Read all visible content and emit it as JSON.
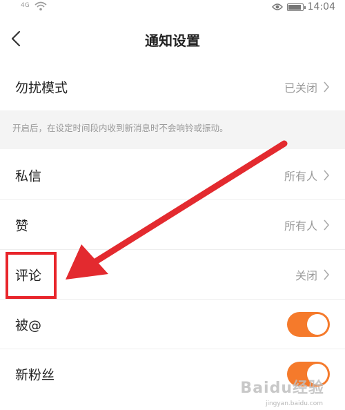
{
  "status_bar": {
    "signal": "4G",
    "time": "14:04",
    "icons": [
      "signal-icon",
      "wifi-icon",
      "eye-icon",
      "battery-icon"
    ]
  },
  "header": {
    "title": "通知设置",
    "back_icon": "chevron-left-icon"
  },
  "settings": {
    "dnd": {
      "label": "勿扰模式",
      "value": "已关闭"
    },
    "hint": "开启后，在设定时间段内收到新消息时不会响铃或振动。",
    "private_message": {
      "label": "私信",
      "value": "所有人"
    },
    "likes": {
      "label": "赞",
      "value": "所有人"
    },
    "comments": {
      "label": "评论",
      "value": "关闭"
    },
    "mentions": {
      "label": "被@",
      "enabled": true
    },
    "new_fans": {
      "label": "新粉丝",
      "enabled": true
    }
  },
  "annotation": {
    "highlight_color": "#e8252b",
    "arrow_color": "#e32a2f"
  },
  "colors": {
    "toggle_on": "#f57a2b",
    "secondary_text": "#999999"
  },
  "watermark": {
    "brand": "Baidu经验",
    "url": "jingyan.baidu.com"
  }
}
